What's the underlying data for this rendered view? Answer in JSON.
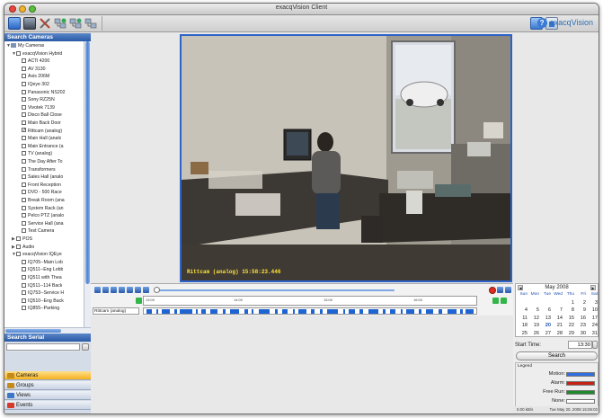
{
  "window": {
    "title": "exacqVision Client"
  },
  "toolbar": {
    "left_icons": [
      "live-view-icon",
      "layout-icon",
      "tools-icon",
      "network-add-icon",
      "network-remove-icon",
      "network-icon"
    ],
    "right_icons": [
      "fullscreen-icon",
      "single-view-icon",
      "help-icon"
    ],
    "logo_text": "exacqVision"
  },
  "sidebar": {
    "search_cameras_title": "Search Cameras",
    "tree": [
      {
        "label": "My Cameras",
        "level": 0,
        "expand": "open",
        "checkbox": false,
        "icon": "network"
      },
      {
        "label": "exacqVision Hybrid",
        "level": 1,
        "expand": "open",
        "checkbox": true
      },
      {
        "label": "ACTi 4200",
        "level": 2,
        "checkbox": true
      },
      {
        "label": "AV 3130",
        "level": 2,
        "checkbox": true
      },
      {
        "label": "Axis 206M",
        "level": 2,
        "checkbox": true
      },
      {
        "label": "IQeye 302",
        "level": 2,
        "checkbox": true
      },
      {
        "label": "Panasonic NS202",
        "level": 2,
        "checkbox": true
      },
      {
        "label": "Sony RZ25N",
        "level": 2,
        "checkbox": true
      },
      {
        "label": "Vivotek 7139",
        "level": 2,
        "checkbox": true
      },
      {
        "label": "Disco Ball Close",
        "level": 2,
        "checkbox": true
      },
      {
        "label": "Main Back Door",
        "level": 2,
        "checkbox": true
      },
      {
        "label": "Rittcam (analog)",
        "level": 2,
        "checkbox": true,
        "checked": true
      },
      {
        "label": "Main Hall (analo",
        "level": 2,
        "checkbox": true
      },
      {
        "label": "Main Entrance (a",
        "level": 2,
        "checkbox": true
      },
      {
        "label": "TV (analog)",
        "level": 2,
        "checkbox": true
      },
      {
        "label": "The Day After To",
        "level": 2,
        "checkbox": true
      },
      {
        "label": "Transformers",
        "level": 2,
        "checkbox": true
      },
      {
        "label": "Sales Hall (analo",
        "level": 2,
        "checkbox": true
      },
      {
        "label": "Front Reception",
        "level": 2,
        "checkbox": true
      },
      {
        "label": "DVD - 500 Race",
        "level": 2,
        "checkbox": true
      },
      {
        "label": "Break Room (ana",
        "level": 2,
        "checkbox": true
      },
      {
        "label": "System Rack (an",
        "level": 2,
        "checkbox": true
      },
      {
        "label": "Pelco PTZ (analo",
        "level": 2,
        "checkbox": true
      },
      {
        "label": "Service Hall (ana",
        "level": 2,
        "checkbox": true
      },
      {
        "label": "Test Camera",
        "level": 2,
        "checkbox": true
      },
      {
        "label": "POS",
        "level": 1,
        "expand": "closed",
        "checkbox": true
      },
      {
        "label": "Audio",
        "level": 1,
        "expand": "closed",
        "checkbox": true
      },
      {
        "label": "exacqVision IQEye",
        "level": 1,
        "expand": "open",
        "checkbox": true
      },
      {
        "label": "IQ705--Main Lob",
        "level": 2,
        "checkbox": true
      },
      {
        "label": "IQ511--Eng Lobb",
        "level": 2,
        "checkbox": true
      },
      {
        "label": "IQ511 with Thea",
        "level": 2,
        "checkbox": true
      },
      {
        "label": "IQ511--114 Back",
        "level": 2,
        "checkbox": true
      },
      {
        "label": "IQ753--Service H",
        "level": 2,
        "checkbox": true
      },
      {
        "label": "IQ510--Eng Back",
        "level": 2,
        "checkbox": true
      },
      {
        "label": "IQ855--Parking",
        "level": 2,
        "checkbox": true
      }
    ],
    "search_serial_title": "Search Serial",
    "nav": [
      {
        "label": "Cameras",
        "active": true,
        "icon": "camera-folder-icon",
        "color": "#c58a1c"
      },
      {
        "label": "Groups",
        "active": false,
        "icon": "groups-folder-icon",
        "color": "#c58a1c"
      },
      {
        "label": "Views",
        "active": false,
        "icon": "views-icon",
        "color": "#3b76c8"
      },
      {
        "label": "Events",
        "active": false,
        "icon": "events-icon",
        "color": "#d73a2a"
      }
    ]
  },
  "video": {
    "overlay": "Rittcam (analog) 15:58:23.446",
    "border_color": "#2d63c8",
    "overlay_color": "#ffe33a"
  },
  "timeline": {
    "track_label": "Rittcam (analog)",
    "ruler_labels": [
      "13:00",
      "14:00",
      "15:00",
      "16:00"
    ],
    "segment_color": "#1e64d2",
    "record_color": "#e02b1f"
  },
  "calendar": {
    "month_label": "May 2008",
    "weekdays": [
      "Sun",
      "Mon",
      "Tue",
      "Wed",
      "Thu",
      "Fri",
      "Sat"
    ],
    "weeks": [
      [
        "",
        "",
        "",
        "",
        "1",
        "2",
        "3"
      ],
      [
        "4",
        "5",
        "6",
        "7",
        "8",
        "9",
        "10"
      ],
      [
        "11",
        "12",
        "13",
        "14",
        "15",
        "16",
        "17"
      ],
      [
        "18",
        "19",
        "20",
        "21",
        "22",
        "23",
        "24"
      ],
      [
        "25",
        "26",
        "27",
        "28",
        "29",
        "30",
        "31"
      ]
    ],
    "selected": "20"
  },
  "search_panel": {
    "start_time_label": "Start Time:",
    "start_time_value": "13:30",
    "search_button": "Search",
    "legend_title": "Legend",
    "legend": [
      {
        "label": "Motion:",
        "color": "#2f6fe0"
      },
      {
        "label": "Alarm:",
        "color": "#c62216"
      },
      {
        "label": "Free Run:",
        "color": "#1f8a2c"
      },
      {
        "label": "None:",
        "color": "#ffffff"
      }
    ]
  },
  "status": {
    "rate": "0.00 kB/s",
    "datetime": "Tue May 20, 2008 15:06:03"
  }
}
